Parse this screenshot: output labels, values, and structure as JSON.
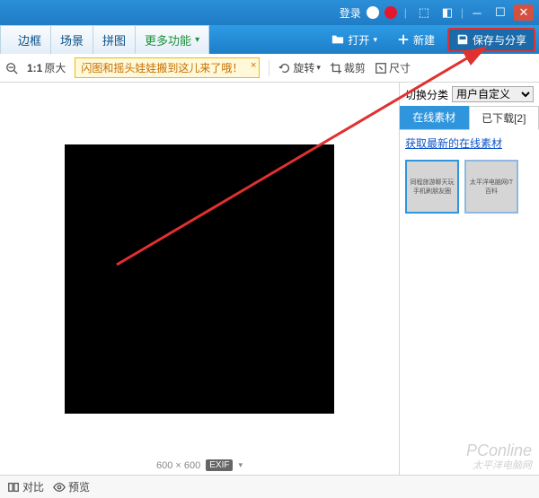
{
  "titlebar": {
    "login": "登录",
    "icons": [
      "qq",
      "weibo"
    ]
  },
  "tabs": {
    "border": "边框",
    "scene": "场景",
    "puzzle": "拼图",
    "more": "更多功能"
  },
  "mainbar": {
    "open": "打开",
    "new": "新建",
    "save_share": "保存与分享"
  },
  "toolbar": {
    "zoom_ratio": "1:1",
    "original": "原大",
    "notice": "闪图和摇头娃娃搬到这儿来了哦！",
    "rotate": "旋转",
    "crop": "裁剪",
    "size": "尺寸"
  },
  "sidebar": {
    "category_label": "切换分类",
    "category_value": "用户自定义",
    "tab_online": "在线素材",
    "tab_downloaded": "已下载[2]",
    "link": "获取最新的在线素材",
    "thumbs": [
      {
        "label": "同程旅游聊天玩手机刷朋友圈"
      },
      {
        "label": "太平洋电脑网IT百科"
      }
    ]
  },
  "canvas": {
    "dimensions": "600 × 600",
    "exif": "EXIF"
  },
  "statusbar": {
    "compare": "对比",
    "preview": "预览"
  },
  "watermark": {
    "line1": "PConline",
    "line2": "太平洋电脑网"
  }
}
